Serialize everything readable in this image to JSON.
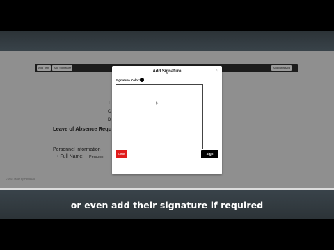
{
  "caption": "or even add their signature if required",
  "toolbar": {
    "add_text": "Add Text",
    "add_signature": "Add Signature",
    "add_dates_fields": "Add Initials/pd"
  },
  "document": {
    "letter_t": "T",
    "letter_c": "C",
    "letter_d": "D",
    "title": "Leave of Absence Requ",
    "section": "Personnel  Information",
    "field_label": "Full Name:",
    "field_value": "Personn",
    "footer_note": "© 2021 Made by PandaDoc"
  },
  "modal": {
    "title": "Add Signature",
    "color_label": "Signature Color:",
    "color": "#000000",
    "clear_label": "Clear",
    "sign_label": "Sign",
    "close_icon": "close-icon"
  }
}
